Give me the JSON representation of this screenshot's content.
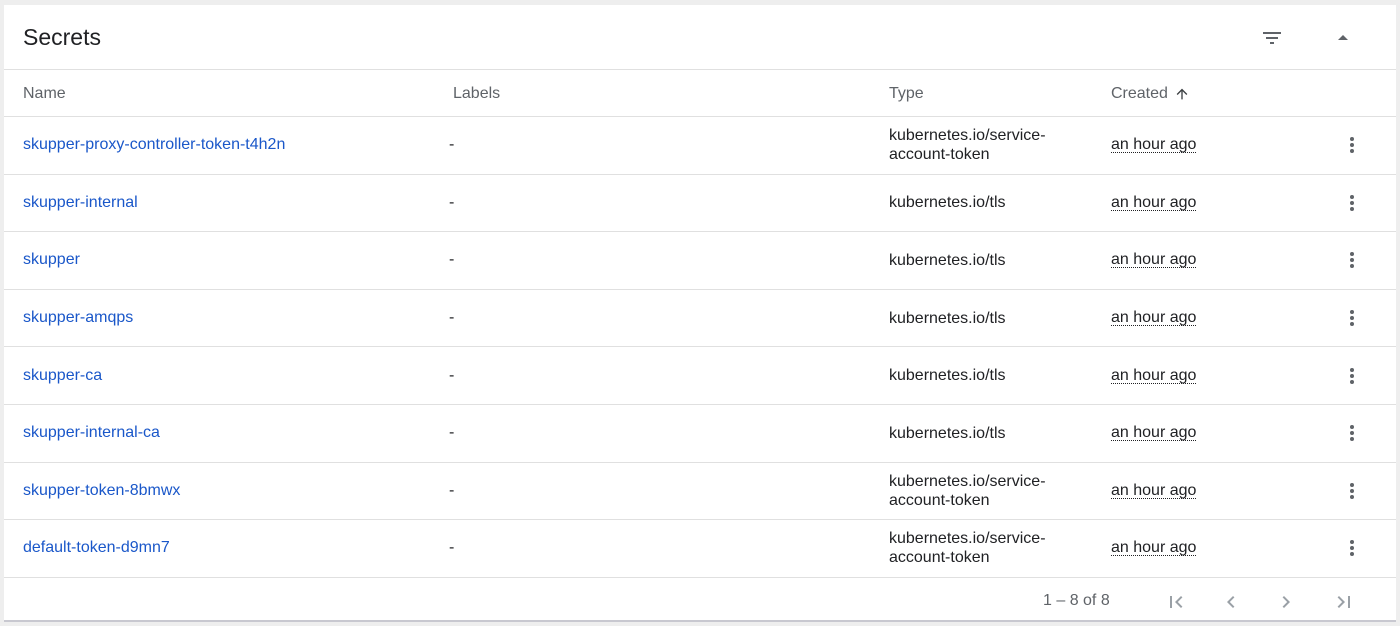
{
  "card": {
    "title": "Secrets",
    "filter_icon": "filter-list-icon",
    "collapse_icon": "arrow-drop-up-icon"
  },
  "table": {
    "columns": {
      "name": "Name",
      "labels": "Labels",
      "type": "Type",
      "created": "Created",
      "sort_icon": "arrow-upward-icon"
    },
    "rows": [
      {
        "name": "skupper-proxy-controller-token-t4h2n",
        "labels": "-",
        "type": "kubernetes.io/service-account-token",
        "created": "an hour ago"
      },
      {
        "name": "skupper-internal",
        "labels": "-",
        "type": "kubernetes.io/tls",
        "created": "an hour ago"
      },
      {
        "name": "skupper",
        "labels": "-",
        "type": "kubernetes.io/tls",
        "created": "an hour ago"
      },
      {
        "name": "skupper-amqps",
        "labels": "-",
        "type": "kubernetes.io/tls",
        "created": "an hour ago"
      },
      {
        "name": "skupper-ca",
        "labels": "-",
        "type": "kubernetes.io/tls",
        "created": "an hour ago"
      },
      {
        "name": "skupper-internal-ca",
        "labels": "-",
        "type": "kubernetes.io/tls",
        "created": "an hour ago"
      },
      {
        "name": "skupper-token-8bmwx",
        "labels": "-",
        "type": "kubernetes.io/service-account-token",
        "created": "an hour ago"
      },
      {
        "name": "default-token-d9mn7",
        "labels": "-",
        "type": "kubernetes.io/service-account-token",
        "created": "an hour ago"
      }
    ],
    "row_menu_icon": "more-vert-icon"
  },
  "pagination": {
    "range": "1 – 8 of 8",
    "first_icon": "first-page-icon",
    "prev_icon": "chevron-left-icon",
    "next_icon": "chevron-right-icon",
    "last_icon": "last-page-icon"
  },
  "colors": {
    "link": "#1a57c9",
    "text": "#202124",
    "muted": "#5f6368",
    "divider": "#e0e0e0",
    "background": "#eeeeee"
  }
}
